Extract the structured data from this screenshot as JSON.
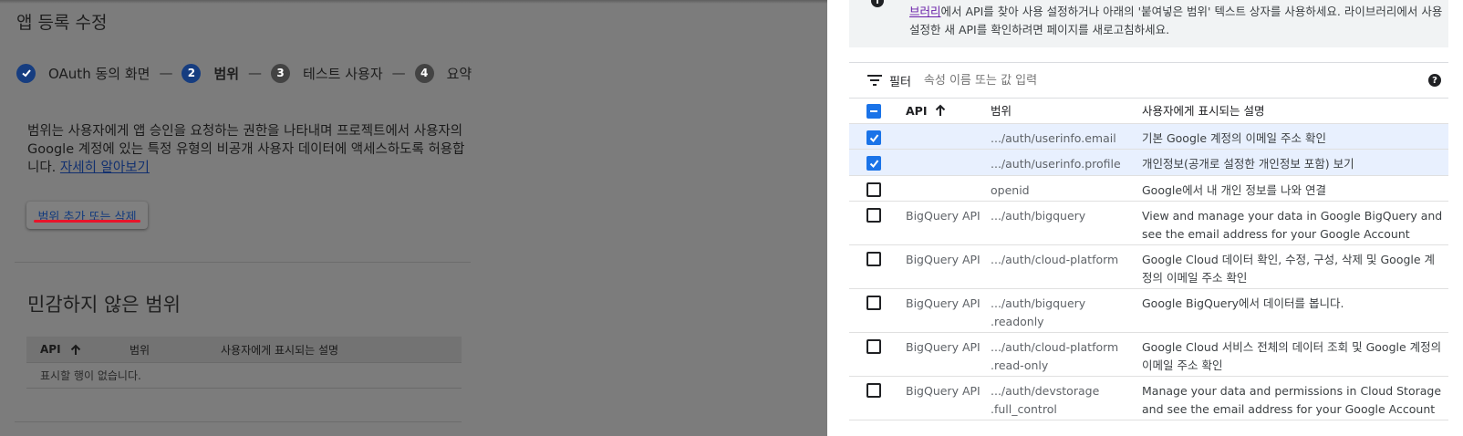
{
  "page": {
    "title": "앱 등록 수정",
    "steps": [
      {
        "number": "",
        "label": "OAuth 동의 화면",
        "state": "done"
      },
      {
        "number": "2",
        "label": "범위",
        "state": "active"
      },
      {
        "number": "3",
        "label": "테스트 사용자",
        "state": "idle"
      },
      {
        "number": "4",
        "label": "요약",
        "state": "idle"
      }
    ],
    "step_separator": "—",
    "description": "범위는 사용자에게 앱 승인을 요청하는 권한을 나타내며 프로젝트에서 사용자의 Google 계정에 있는 특정 유형의 비공개 사용자 데이터에 액세스하도록 허용합니다.",
    "learn_more": "자세히 알아보기",
    "add_scope_button": "범위 추가 또는 삭제",
    "non_sensitive_title": "민감하지 않은 범위",
    "mini_table": {
      "headers": [
        "API",
        "범위",
        "사용자에게 표시되는 설명"
      ],
      "empty": "표시할 행이 없습니다."
    }
  },
  "panel": {
    "info_link": "브러리",
    "info_text": "에서 API를 찾아 사용 설정하거나 아래의 '붙여넣은 범위' 텍스트 상자를 사용하세요. 라이브러리에서 사용 설정한 새 API를 확인하려면 페이지를 새로고침하세요.",
    "filter_label": "필터",
    "filter_placeholder": "속성 이름 또는 값 입력",
    "headers": {
      "api": "API",
      "scope": "범위",
      "desc": "사용자에게 표시되는 설명"
    },
    "rows": [
      {
        "checked": true,
        "api": "",
        "scope": ".../auth/userinfo.email",
        "desc": "기본 Google 계정의 이메일 주소 확인"
      },
      {
        "checked": true,
        "api": "",
        "scope": ".../auth/userinfo.profile",
        "desc": "개인정보(공개로 설정한 개인정보 포함) 보기"
      },
      {
        "checked": false,
        "api": "",
        "scope": "openid",
        "desc": "Google에서 내 개인 정보를 나와 연결"
      },
      {
        "checked": false,
        "api": "BigQuery API",
        "scope": ".../auth/bigquery",
        "desc": "View and manage your data in Google BigQuery and see the email address for your Google Account"
      },
      {
        "checked": false,
        "api": "BigQuery API",
        "scope": ".../auth/cloud-platform",
        "desc": "Google Cloud 데이터 확인, 수정, 구성, 삭제 및 Google 계정의 이메일 주소 확인"
      },
      {
        "checked": false,
        "api": "BigQuery API",
        "scope": ".../auth/bigquery .readonly",
        "desc": "Google BigQuery에서 데이터를 봅니다."
      },
      {
        "checked": false,
        "api": "BigQuery API",
        "scope": ".../auth/cloud-platform .read-only",
        "desc": "Google Cloud 서비스 전체의 데이터 조회 및 Google 계정의 이메일 주소 확인"
      },
      {
        "checked": false,
        "api": "BigQuery API",
        "scope": ".../auth/devstorage .full_control",
        "desc": "Manage your data and permissions in Cloud Storage and see the email address for your Google Account"
      }
    ]
  }
}
